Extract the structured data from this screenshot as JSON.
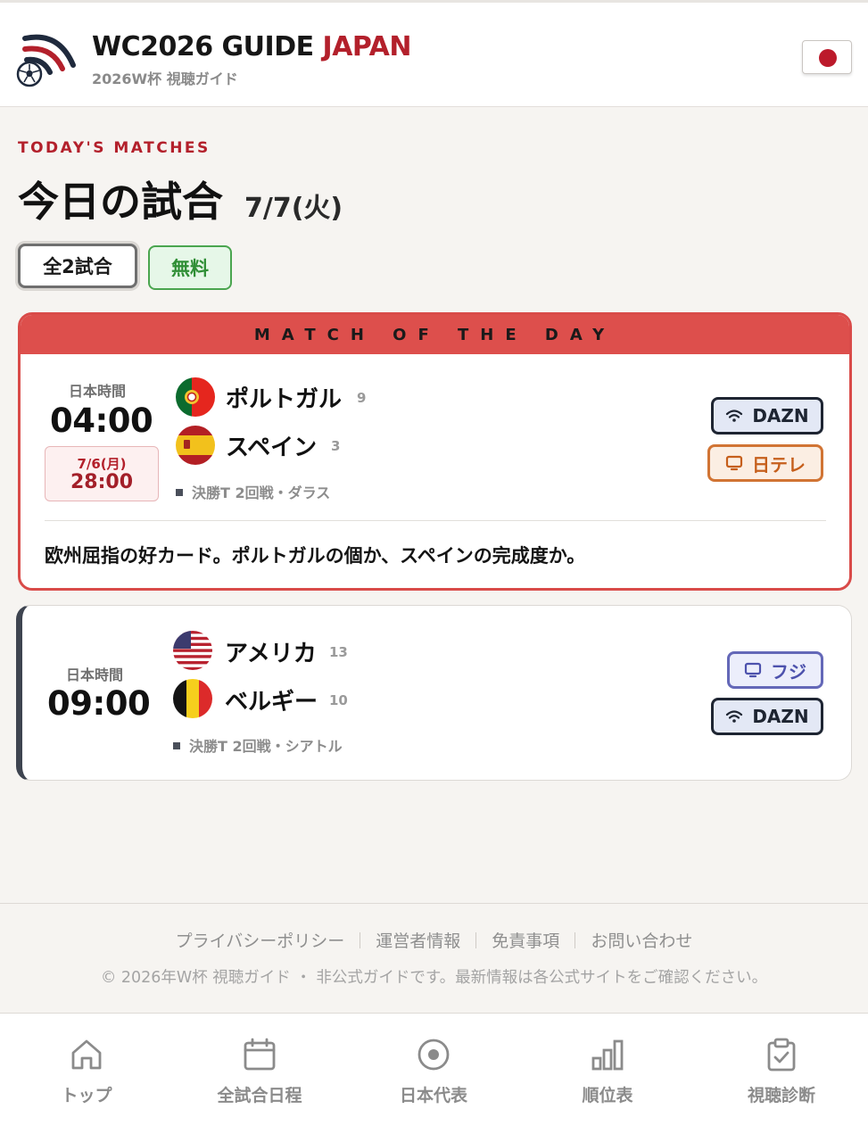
{
  "header": {
    "title_main": "WC2026 GUIDE",
    "title_accent": "JAPAN",
    "subtitle": "2026W杯 視聴ガイド",
    "accent_color": "#b3202b"
  },
  "section": {
    "eyebrow": "TODAY'S MATCHES",
    "title": "今日の試合",
    "date": "7/7(火)"
  },
  "filters": [
    {
      "label": "全2試合",
      "selected": true
    },
    {
      "label": "無料",
      "selected": false
    }
  ],
  "featured_banner": "MATCH OF THE DAY",
  "matches": [
    {
      "jst_label": "日本時間",
      "time": "04:00",
      "local_date": "7/6(月)",
      "local_time": "28:00",
      "home": {
        "name": "ポルトガル",
        "rank": "9",
        "flag_icon": "portugal-flag-icon"
      },
      "away": {
        "name": "スペイン",
        "rank": "3",
        "flag_icon": "spain-flag-icon"
      },
      "venue": "決勝T 2回戦・ダラス",
      "broadcasters": [
        {
          "label": "DAZN",
          "icon": "wifi-icon"
        },
        {
          "label": "日テレ",
          "icon": "tv-icon"
        }
      ],
      "comment": "欧州屈指の好カード。ポルトガルの個か、スペインの完成度か。"
    },
    {
      "jst_label": "日本時間",
      "time": "09:00",
      "home": {
        "name": "アメリカ",
        "rank": "13",
        "flag_icon": "usa-flag-icon"
      },
      "away": {
        "name": "ベルギー",
        "rank": "10",
        "flag_icon": "belgium-flag-icon"
      },
      "venue": "決勝T 2回戦・シアトル",
      "broadcasters": [
        {
          "label": "フジ",
          "icon": "tv-icon"
        },
        {
          "label": "DAZN",
          "icon": "wifi-icon"
        }
      ]
    }
  ],
  "footer": {
    "links": [
      "プライバシーポリシー",
      "運営者情報",
      "免責事項",
      "お問い合わせ"
    ],
    "copyright": "© 2026年W杯 視聴ガイド ・ 非公式ガイドです。最新情報は各公式サイトをご確認ください。"
  },
  "bottom_nav": [
    {
      "label": "トップ",
      "icon": "home-icon"
    },
    {
      "label": "全試合日程",
      "icon": "calendar-icon"
    },
    {
      "label": "日本代表",
      "icon": "target-icon"
    },
    {
      "label": "順位表",
      "icon": "bar-chart-icon"
    },
    {
      "label": "視聴診断",
      "icon": "clipboard-check-icon"
    }
  ]
}
